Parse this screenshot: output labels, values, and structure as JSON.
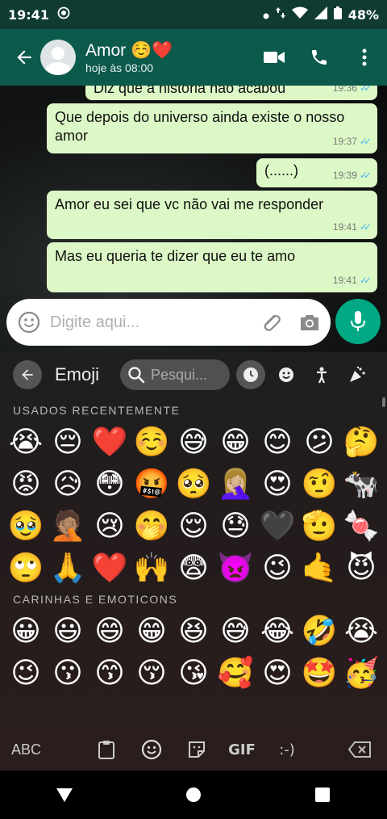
{
  "status_bar": {
    "time": "19:41",
    "battery": "48%"
  },
  "header": {
    "contact_name": "Amor ☺️❤️",
    "last_seen": "hoje às 08:00"
  },
  "messages": [
    {
      "text": "Diz que a história não acabou",
      "time": "19:36"
    },
    {
      "text": "Que depois do universo ainda existe o nosso amor",
      "time": "19:37"
    },
    {
      "text": "(......)",
      "time": "19:39"
    },
    {
      "text": "Amor eu sei que vc não vai me responder",
      "time": "19:41"
    },
    {
      "text": "Mas eu queria te dizer que eu te amo",
      "time": "19:41"
    }
  ],
  "input": {
    "placeholder": "Digite aqui..."
  },
  "keyboard": {
    "title": "Emoji",
    "search_placeholder": "Pesqui...",
    "section_recent": "USADOS RECENTEMENTE",
    "section_faces": "CARINHAS E EMOTICONS",
    "recent_emojis": [
      "😭",
      "😔",
      "❤️",
      "☺️",
      "😅",
      "😁",
      "😊",
      "😕",
      "🤔",
      "😡",
      "😥",
      "😳",
      "🤬",
      "🥺",
      "🤦🏼‍♀️",
      "😍",
      "🤨",
      "🐄",
      "🥹",
      "🤦🏽",
      "😢",
      "🤭",
      "😌",
      "😓",
      "🖤",
      "🫡",
      "🍬",
      "🙄",
      "🙏",
      "❤️",
      "🙌",
      "😨",
      "👿",
      "😉",
      "🤙",
      "😈"
    ],
    "face_emojis": [
      "😀",
      "😃",
      "😄",
      "😁",
      "😆",
      "😅",
      "😂",
      "🤣",
      "😭",
      "😉",
      "😗",
      "😙",
      "😚",
      "😘",
      "🥰",
      "😍",
      "🤩",
      "🥳"
    ],
    "bottom_abc": "ABC",
    "bottom_gif": "GIF",
    "bottom_emoticon": ":-)"
  },
  "colors": {
    "header": "#0c5a4c",
    "bubble": "#dcf8c6",
    "accent": "#00a884",
    "ticks": "#4fb6ec"
  }
}
